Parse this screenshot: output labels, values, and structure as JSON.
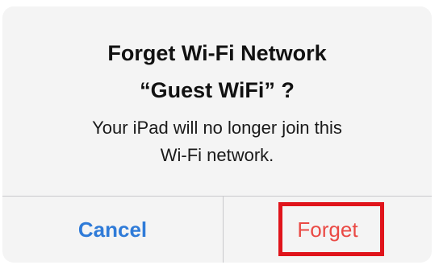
{
  "alert": {
    "title_line1": "Forget Wi-Fi Network",
    "title_line2": "“Guest WiFi” ?",
    "message_line1": "Your iPad will no longer join this",
    "message_line2": "Wi-Fi network.",
    "buttons": {
      "cancel_label": "Cancel",
      "forget_label": "Forget"
    }
  },
  "colors": {
    "cancel_text": "#2f7bd8",
    "forget_text": "#ea4a45",
    "highlight_border": "#e0141b",
    "alert_background": "#f4f4f4"
  }
}
